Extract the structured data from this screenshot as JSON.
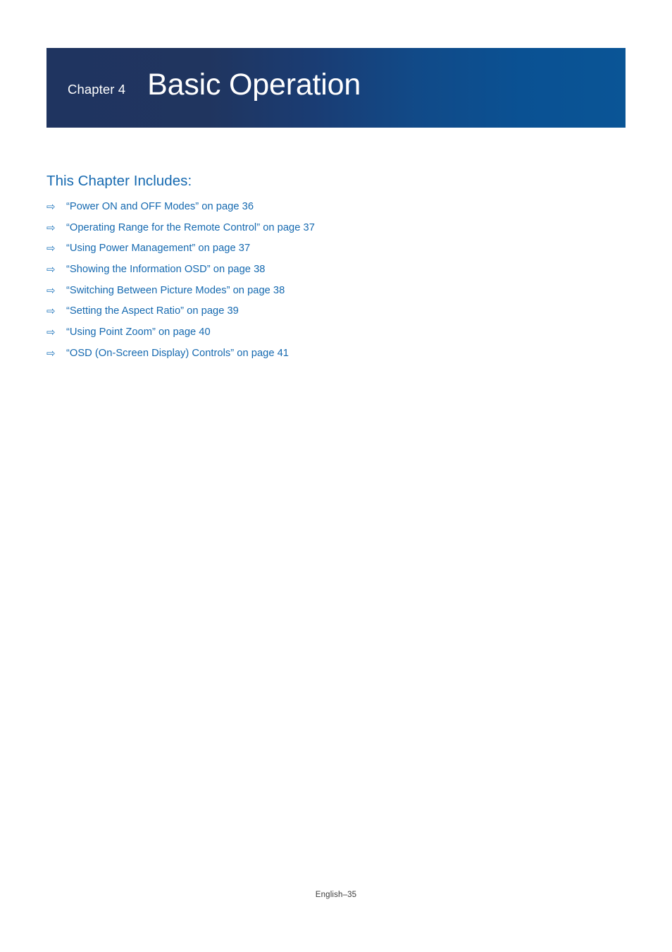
{
  "document": {
    "page_background": "#ffffff",
    "footer_text": "English–35"
  },
  "banner": {
    "chapter_label": "Chapter 4",
    "chapter_title": "Basic Operation",
    "gradient_start": "#1f3460",
    "gradient_end": "#0a5596",
    "text_color": "#ffffff"
  },
  "contents": {
    "heading": "This Chapter Includes:",
    "heading_color": "#1569b0",
    "link_color": "#1569b0",
    "arrow_icon": "⇨",
    "items": [
      {
        "label": "“Power ON and OFF Modes” on page 36"
      },
      {
        "label": "“Operating Range for the Remote Control” on page 37"
      },
      {
        "label": "“Using Power Management” on page 37"
      },
      {
        "label": "“Showing the Information OSD” on page 38"
      },
      {
        "label": "“Switching Between Picture Modes” on page 38"
      },
      {
        "label": "“Setting the Aspect Ratio” on page 39"
      },
      {
        "label": "“Using Point Zoom” on page 40"
      },
      {
        "label": "“OSD (On-Screen Display) Controls” on page 41"
      }
    ]
  }
}
